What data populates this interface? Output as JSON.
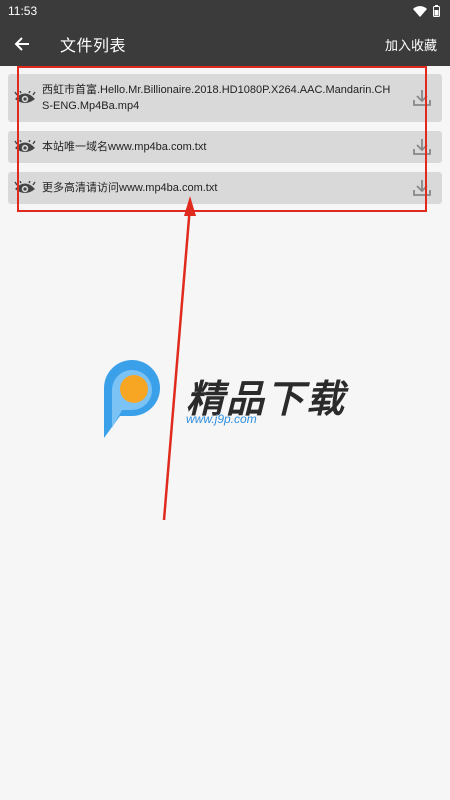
{
  "status_bar": {
    "time": "11:53",
    "icons": [
      "wifi-icon",
      "battery-icon"
    ]
  },
  "app_bar": {
    "back_icon": "arrow-left-icon",
    "title": "文件列表",
    "action_label": "加入收藏"
  },
  "files": [
    {
      "name": "西虹市首富.Hello.Mr.Billionaire.2018.HD1080P.X264.AAC.Mandarin.CHS-ENG.Mp4Ba.mp4",
      "leading_icon": "eye-icon",
      "trailing_icon": "download-icon"
    },
    {
      "name": "本站唯一域名www.mp4ba.com.txt",
      "leading_icon": "eye-icon",
      "trailing_icon": "download-icon"
    },
    {
      "name": "更多高清请访问www.mp4ba.com.txt",
      "leading_icon": "eye-icon",
      "trailing_icon": "download-icon"
    }
  ],
  "watermark": {
    "brand": "精品下载",
    "url": "www.j9p.com"
  },
  "colors": {
    "bar": "#3b3b3b",
    "item_bg": "#d9d9d9",
    "annotation_red": "#e02a1e",
    "logo_blue": "#2f8fe0",
    "logo_orange": "#f6a623"
  }
}
